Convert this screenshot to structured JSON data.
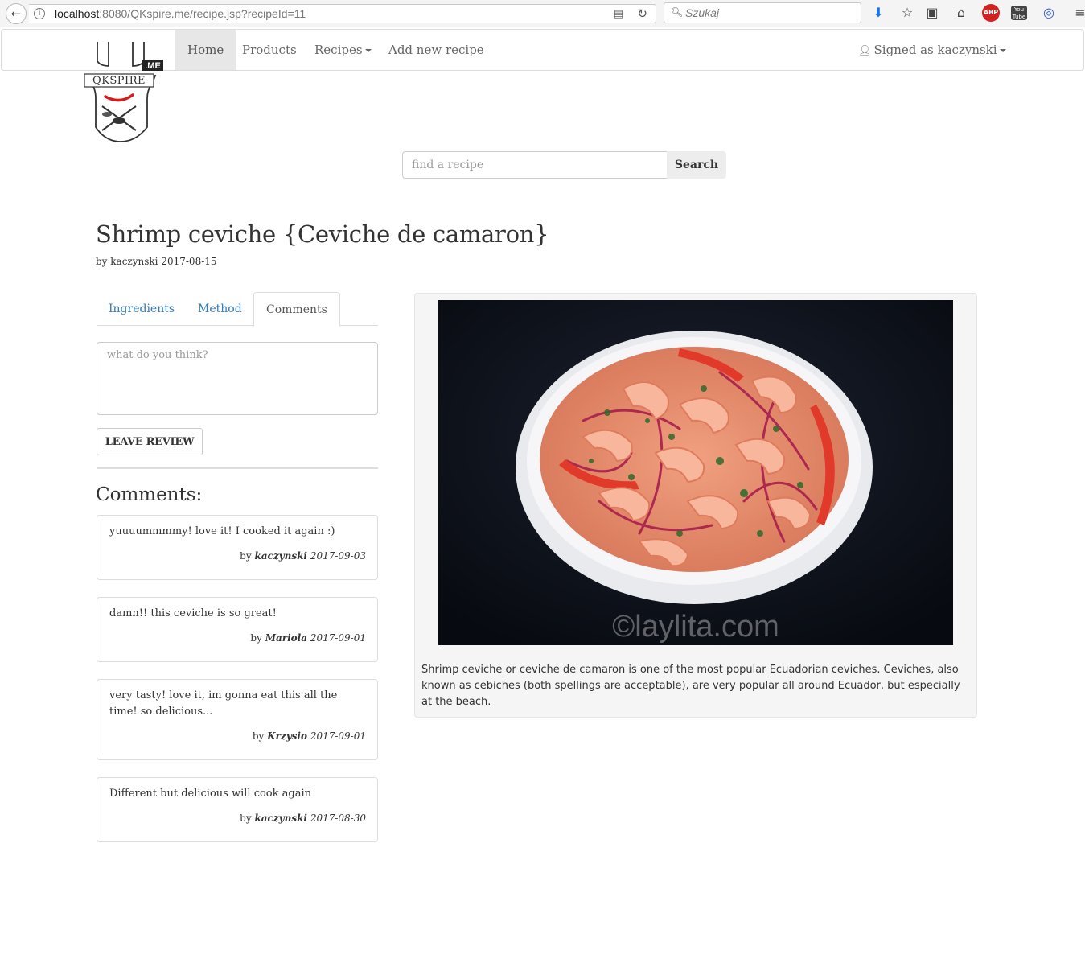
{
  "browser": {
    "url_host": "localhost",
    "url_rest": ":8080/QKspire.me/recipe.jsp?recipeId=11",
    "search_placeholder": "Szukaj",
    "toolbar_icons": [
      "download-icon",
      "bookmark-star-icon",
      "reading-list-icon",
      "home-icon",
      "adblock-icon",
      "youtube-icon",
      "extension-icon",
      "menu-icon"
    ]
  },
  "logo": {
    "text": "QKSPIRE",
    "suffix": ".ME"
  },
  "nav": {
    "home": "Home",
    "products": "Products",
    "recipes": "Recipes",
    "add_recipe": "Add new recipe",
    "user": "Signed as kaczynski"
  },
  "search": {
    "placeholder": "find a recipe",
    "button": "Search"
  },
  "recipe": {
    "title": "Shrimp ceviche {Ceviche de camaron}",
    "byline": "by kaczynski 2017-08-15",
    "description": "Shrimp ceviche or ceviche de camaron is one of the most popular Ecuadorian ceviches. Ceviches, also known as cebiches (both spellings are acceptable), are very popular all around Ecuador, but especially at the beach.",
    "image_watermark": "©laylita.com"
  },
  "tabs": {
    "ingredients": "Ingredients",
    "method": "Method",
    "comments": "Comments"
  },
  "review": {
    "placeholder": "what do you think?",
    "button": "LEAVE REVIEW"
  },
  "comments_heading": "Comments:",
  "comments": [
    {
      "text": "yuuuummmmy! love it! I cooked it again :)",
      "by": "by",
      "author": "kaczynski",
      "date": "2017-09-03"
    },
    {
      "text": "damn!! this ceviche is so great!",
      "by": "by",
      "author": "Mariola",
      "date": "2017-09-01"
    },
    {
      "text": "very tasty! love it, im gonna eat this all the time! so delicious...",
      "by": "by",
      "author": "Krzysio",
      "date": "2017-09-01"
    },
    {
      "text": "Different but delicious will cook again",
      "by": "by",
      "author": "kaczynski",
      "date": "2017-08-30"
    }
  ]
}
